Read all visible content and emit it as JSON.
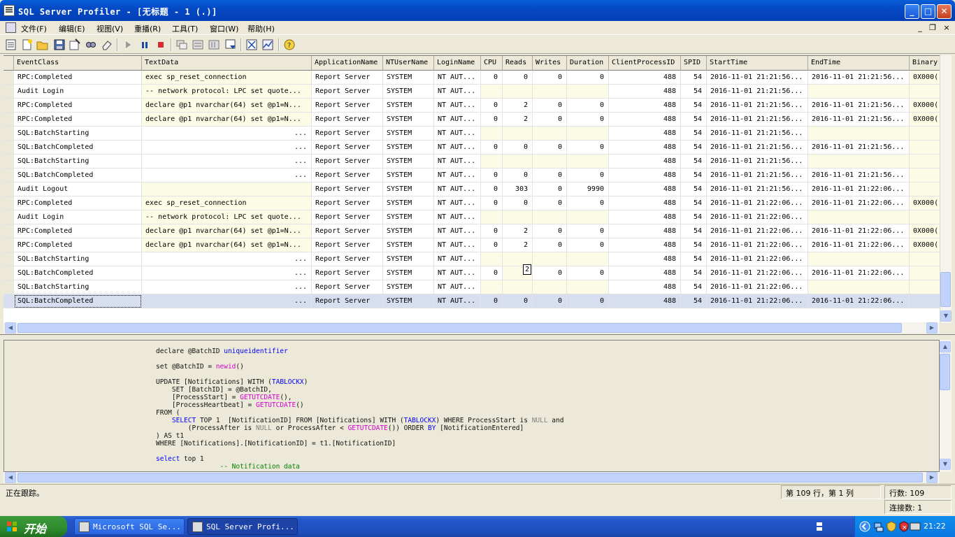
{
  "window": {
    "title": "SQL Server Profiler - [无标题 - 1 (.)]",
    "minimize": "_",
    "maximize": "□",
    "close": "✕"
  },
  "menu": {
    "items": [
      "文件(F)",
      "编辑(E)",
      "视图(V)",
      "重播(R)",
      "工具(T)",
      "窗口(W)",
      "帮助(H)"
    ],
    "mdi_min": "_",
    "mdi_restore": "❐",
    "mdi_close": "×"
  },
  "toolbar": {
    "icons": [
      "properties-icon",
      "new-trace-icon",
      "open-icon",
      "save-icon",
      "new-template-icon",
      "find-icon",
      "clear-icon",
      "run-icon",
      "pause-icon",
      "stop-icon",
      "column-filter-icon",
      "group-icon",
      "auto-scroll-icon",
      "scroll-icon",
      "trace-properties-icon",
      "performance-monitor-icon",
      "help-icon"
    ]
  },
  "grid": {
    "columns": [
      "EventClass",
      "TextData",
      "ApplicationName",
      "NTUserName",
      "LoginName",
      "CPU",
      "Reads",
      "Writes",
      "Duration",
      "ClientProcessID",
      "SPID",
      "StartTime",
      "EndTime",
      "Binary"
    ],
    "rows": [
      [
        "RPC:Completed",
        "exec sp_reset_connection",
        "Report Server",
        "SYSTEM",
        "NT AUT...",
        "0",
        "0",
        "0",
        "0",
        "488",
        "54",
        "2016-11-01 21:21:56...",
        "2016-11-01 21:21:56...",
        "0X000("
      ],
      [
        "Audit Login",
        "-- network protocol: LPC  set quote...",
        "Report Server",
        "SYSTEM",
        "NT AUT...",
        "",
        "",
        "",
        "",
        "488",
        "54",
        "2016-11-01 21:21:56...",
        "",
        ""
      ],
      [
        "RPC:Completed",
        "declare @p1 nvarchar(64)  set @p1=N...",
        "Report Server",
        "SYSTEM",
        "NT AUT...",
        "0",
        "2",
        "0",
        "0",
        "488",
        "54",
        "2016-11-01 21:21:56...",
        "2016-11-01 21:21:56...",
        "0X000("
      ],
      [
        "RPC:Completed",
        "declare @p1 nvarchar(64)  set @p1=N...",
        "Report Server",
        "SYSTEM",
        "NT AUT...",
        "0",
        "2",
        "0",
        "0",
        "488",
        "54",
        "2016-11-01 21:21:56...",
        "2016-11-01 21:21:56...",
        "0X000("
      ],
      [
        "SQL:BatchStarting",
        "...",
        "Report Server",
        "SYSTEM",
        "NT AUT...",
        "",
        "",
        "",
        "",
        "488",
        "54",
        "2016-11-01 21:21:56...",
        "",
        ""
      ],
      [
        "SQL:BatchCompleted",
        "...",
        "Report Server",
        "SYSTEM",
        "NT AUT...",
        "0",
        "0",
        "0",
        "0",
        "488",
        "54",
        "2016-11-01 21:21:56...",
        "2016-11-01 21:21:56...",
        ""
      ],
      [
        "SQL:BatchStarting",
        "...",
        "Report Server",
        "SYSTEM",
        "NT AUT...",
        "",
        "",
        "",
        "",
        "488",
        "54",
        "2016-11-01 21:21:56...",
        "",
        ""
      ],
      [
        "SQL:BatchCompleted",
        "...",
        "Report Server",
        "SYSTEM",
        "NT AUT...",
        "0",
        "0",
        "0",
        "0",
        "488",
        "54",
        "2016-11-01 21:21:56...",
        "2016-11-01 21:21:56...",
        ""
      ],
      [
        "Audit Logout",
        "",
        "Report Server",
        "SYSTEM",
        "NT AUT...",
        "0",
        "303",
        "0",
        "9990",
        "488",
        "54",
        "2016-11-01 21:21:56...",
        "2016-11-01 21:22:06...",
        ""
      ],
      [
        "RPC:Completed",
        "exec sp_reset_connection",
        "Report Server",
        "SYSTEM",
        "NT AUT...",
        "0",
        "0",
        "0",
        "0",
        "488",
        "54",
        "2016-11-01 21:22:06...",
        "2016-11-01 21:22:06...",
        "0X000("
      ],
      [
        "Audit Login",
        "-- network protocol: LPC  set quote...",
        "Report Server",
        "SYSTEM",
        "NT AUT...",
        "",
        "",
        "",
        "",
        "488",
        "54",
        "2016-11-01 21:22:06...",
        "",
        ""
      ],
      [
        "RPC:Completed",
        "declare @p1 nvarchar(64)  set @p1=N...",
        "Report Server",
        "SYSTEM",
        "NT AUT...",
        "0",
        "2",
        "0",
        "0",
        "488",
        "54",
        "2016-11-01 21:22:06...",
        "2016-11-01 21:22:06...",
        "0X000("
      ],
      [
        "RPC:Completed",
        "declare @p1 nvarchar(64)  set @p1=N...",
        "Report Server",
        "SYSTEM",
        "NT AUT...",
        "0",
        "2",
        "0",
        "0",
        "488",
        "54",
        "2016-11-01 21:22:06...",
        "2016-11-01 21:22:06...",
        "0X000("
      ],
      [
        "SQL:BatchStarting",
        "...",
        "Report Server",
        "SYSTEM",
        "NT AUT...",
        "",
        "",
        "",
        "",
        "488",
        "54",
        "2016-11-01 21:22:06...",
        "",
        ""
      ],
      [
        "SQL:BatchCompleted",
        "...",
        "Report Server",
        "SYSTEM",
        "NT AUT...",
        "0",
        "",
        "0",
        "0",
        "488",
        "54",
        "2016-11-01 21:22:06...",
        "2016-11-01 21:22:06...",
        ""
      ],
      [
        "SQL:BatchStarting",
        "...",
        "Report Server",
        "SYSTEM",
        "NT AUT...",
        "",
        "",
        "",
        "",
        "488",
        "54",
        "2016-11-01 21:22:06...",
        "",
        ""
      ],
      [
        "SQL:BatchCompleted",
        "...",
        "Report Server",
        "SYSTEM",
        "NT AUT...",
        "0",
        "0",
        "0",
        "0",
        "488",
        "54",
        "2016-11-01 21:22:06...",
        "2016-11-01 21:22:06...",
        ""
      ]
    ],
    "tooltip": "2"
  },
  "sql": {
    "line1": "declare @BatchID uniqueidentifier",
    "line2": "set @BatchID = newid()",
    "line3": "UPDATE [Notifications] WITH (TABLOCKX)",
    "line4": "    SET [BatchID] = @BatchID,",
    "line5": "    [ProcessStart] = GETUTCDATE(),",
    "line6": "    [ProcessHeartbeat] = GETUTCDATE()",
    "line7": "FROM (",
    "line8": "    SELECT TOP 1  [NotificationID] FROM [Notifications] WITH (TABLOCKX) WHERE ProcessStart is NULL and",
    "line9": "        (ProcessAfter is NULL or ProcessAfter < GETUTCDATE()) ORDER BY [NotificationEntered]",
    "line10": ") AS t1",
    "line11": "WHERE [Notifications].[NotificationID] = t1.[NotificationID]",
    "line12": "select top 1",
    "line13": "                -- Notification data"
  },
  "status": {
    "tracing": "正在跟踪。",
    "position": "第 109 行，第 1 列",
    "rows": "行数: 109",
    "connections": "连接数: 1"
  },
  "taskbar": {
    "start": "开始",
    "tasks": [
      "Microsoft SQL Se...",
      "SQL Server Profi..."
    ],
    "clock": "21:22"
  }
}
